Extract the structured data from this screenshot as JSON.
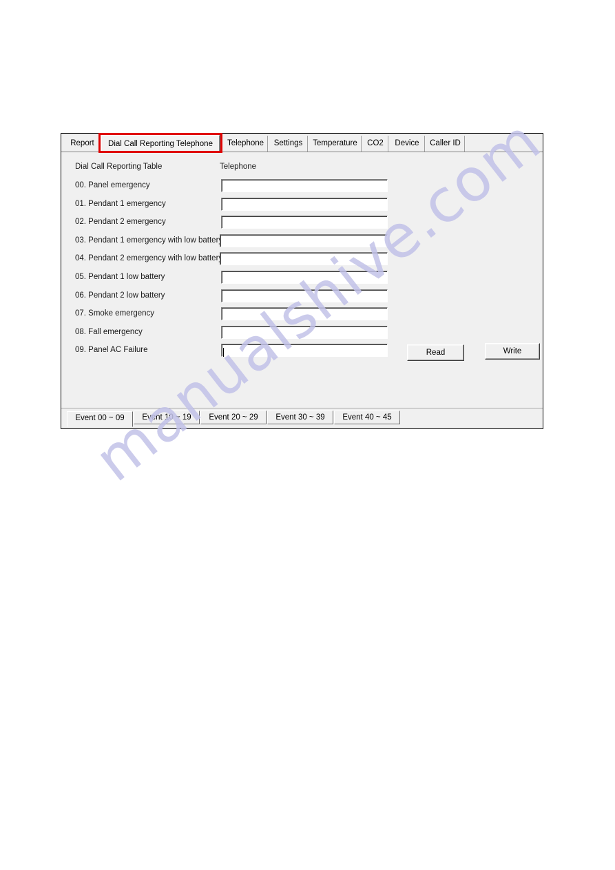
{
  "window": {
    "top_tabs": [
      {
        "label": "Report",
        "selected": false
      },
      {
        "label": "Dial Call Reporting Telephone",
        "selected": true
      },
      {
        "label": "Telephone",
        "selected": false
      },
      {
        "label": "Settings",
        "selected": false
      },
      {
        "label": "Temperature",
        "selected": false
      },
      {
        "label": "CO2",
        "selected": false
      },
      {
        "label": "Device",
        "selected": false
      },
      {
        "label": "Caller ID",
        "selected": false
      }
    ],
    "headers": {
      "table": "Dial Call Reporting Table",
      "telephone": "Telephone"
    },
    "rows": [
      {
        "label": "00. Panel emergency",
        "value": ""
      },
      {
        "label": "01. Pendant 1 emergency",
        "value": ""
      },
      {
        "label": "02. Pendant 2 emergency",
        "value": ""
      },
      {
        "label": "03. Pendant 1 emergency with low battery",
        "value": ""
      },
      {
        "label": "04. Pendant 2 emergency with low battery",
        "value": ""
      },
      {
        "label": "05. Pendant 1 low battery",
        "value": ""
      },
      {
        "label": "06. Pendant 2 low battery",
        "value": ""
      },
      {
        "label": "07. Smoke emergency",
        "value": ""
      },
      {
        "label": "08. Fall emergency",
        "value": ""
      },
      {
        "label": "09. Panel AC Failure",
        "value": ""
      }
    ],
    "buttons": {
      "read": "Read",
      "write": "Write"
    },
    "bottom_tabs": [
      {
        "label": "Event 00 ~ 09",
        "selected": true
      },
      {
        "label": "Event 10 ~ 19",
        "selected": false
      },
      {
        "label": "Event 20 ~ 29",
        "selected": false
      },
      {
        "label": "Event 30 ~ 39",
        "selected": false
      },
      {
        "label": "Event 40 ~ 45",
        "selected": false
      }
    ]
  },
  "annotation": {
    "highlight_color": "#e00000"
  },
  "watermark": {
    "text": "manualshive.com",
    "color": "#c2c2e8"
  }
}
